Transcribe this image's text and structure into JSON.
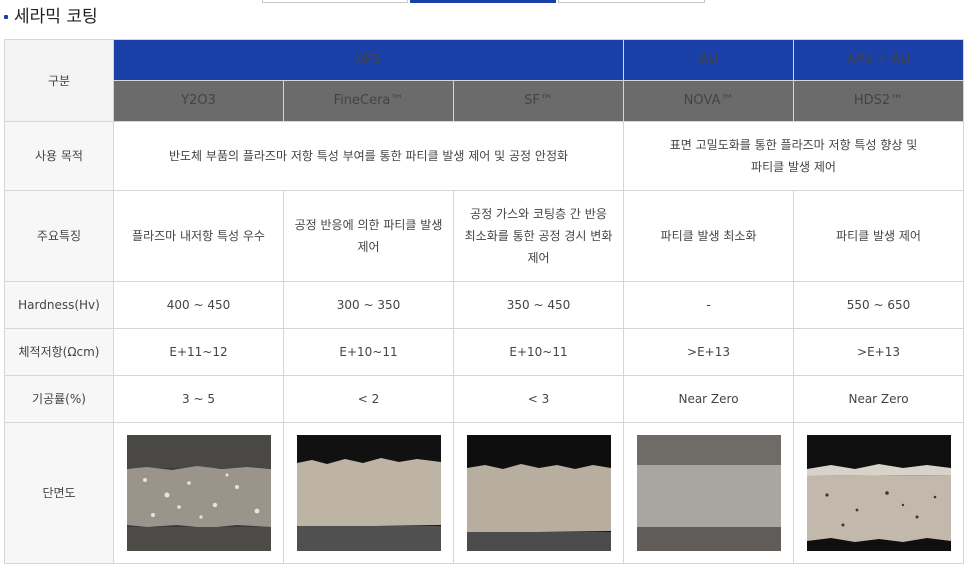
{
  "section": {
    "title": "세라믹 코팅"
  },
  "table": {
    "category_header": "구분",
    "groups": [
      "APS",
      "AD",
      "APS + AD"
    ],
    "products": [
      "Y2O3",
      "FineCera™",
      "SF™",
      "NOVA™",
      "HDS2™"
    ],
    "rows": {
      "purpose": {
        "label": "사용 목적",
        "aps": "반도체 부품의 플라즈마 저항 특성 부여를 통한 파티클 발생 제어 및 공정 안정화",
        "ad_line1": "표면 고밀도화를 통한 플라즈마 저항 특성 향상 및",
        "ad_line2": "파티클 발생 제어"
      },
      "features": {
        "label": "주요특징",
        "values": [
          [
            "플라즈마 내저항 특성 우수"
          ],
          [
            "공정 반응에 의한 파티클 발생",
            "제어"
          ],
          [
            "공정 가스와 코팅층 간 반응",
            "최소화를 통한 공정 경시 변화",
            "제어"
          ],
          [
            "파티클 발생 최소화"
          ],
          [
            "파티클 발생 제어"
          ]
        ]
      },
      "hardness": {
        "label": "Hardness(Hv)",
        "values": [
          "400 ~ 450",
          "300 ~ 350",
          "350 ~ 450",
          "-",
          "550 ~ 650"
        ]
      },
      "resistivity": {
        "label": "체적저항(Ωcm)",
        "values": [
          "E+11~12",
          "E+10~11",
          "E+10~11",
          ">E+13",
          ">E+13"
        ]
      },
      "porosity": {
        "label": "기공률(%)",
        "values": [
          "3 ~ 5",
          "< 2",
          "< 3",
          "Near Zero",
          "Near Zero"
        ]
      },
      "cross_section": {
        "label": "단면도"
      }
    }
  },
  "colors": {
    "group_header": "#1a40a8",
    "sub_header": "#6b6b6b",
    "label_bg": "#f3f3f3"
  }
}
